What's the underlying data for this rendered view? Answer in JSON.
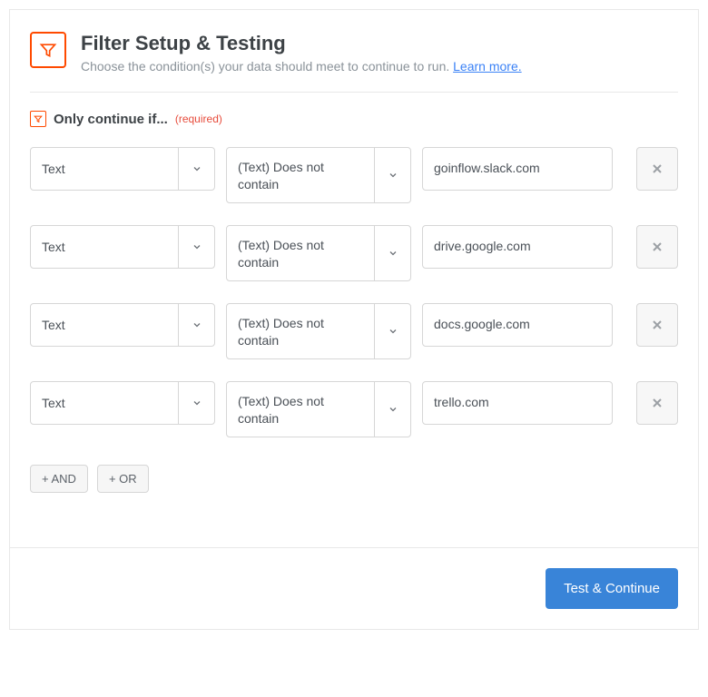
{
  "header": {
    "title": "Filter Setup & Testing",
    "subtitle": "Choose the condition(s) your data should meet to continue to run. ",
    "learn_more": "Learn more."
  },
  "section": {
    "label": "Only continue if...",
    "required": "(required)"
  },
  "rows": [
    {
      "field": "Text",
      "condition": "(Text) Does not contain",
      "value": "goinflow.slack.com"
    },
    {
      "field": "Text",
      "condition": "(Text) Does not contain",
      "value": "drive.google.com"
    },
    {
      "field": "Text",
      "condition": "(Text) Does not contain",
      "value": "docs.google.com"
    },
    {
      "field": "Text",
      "condition": "(Text) Does not contain",
      "value": "trello.com"
    }
  ],
  "buttons": {
    "and": "+ AND",
    "or": "+ OR",
    "test": "Test & Continue"
  }
}
